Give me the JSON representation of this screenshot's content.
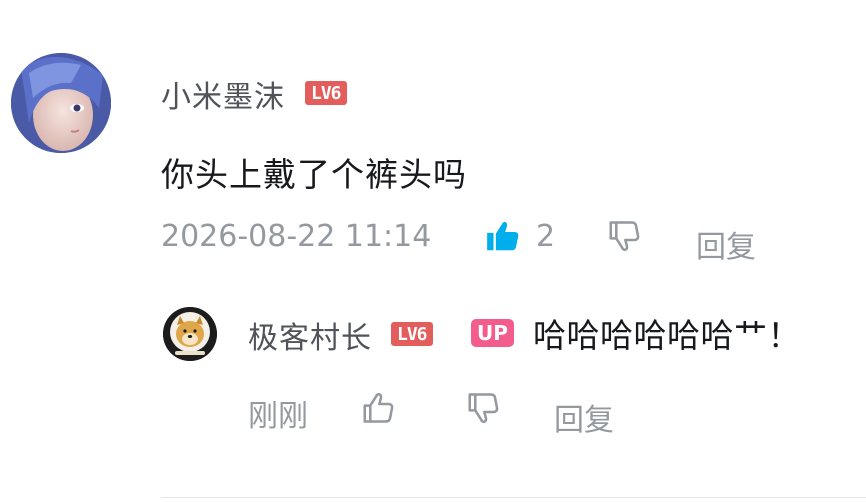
{
  "comment": {
    "username": "小米墨沫",
    "level": "LV6",
    "text": "你头上戴了个裤头吗",
    "timestamp": "2026-08-22 11:14",
    "like_count": "2",
    "reply_label": "回复",
    "liked": true,
    "avatar_icon": "anime-avatar"
  },
  "reply": {
    "username": "极客村长",
    "level": "LV6",
    "up_badge": "UP",
    "text": "哈哈哈哈哈哈艹！",
    "timestamp": "刚刚",
    "reply_label": "回复",
    "avatar_icon": "doge-avatar"
  },
  "colors": {
    "like_active": "#00aeec",
    "icon_gray": "#9499a0",
    "level_red": "#e35d5d",
    "up_pink": "#f25d8e"
  }
}
